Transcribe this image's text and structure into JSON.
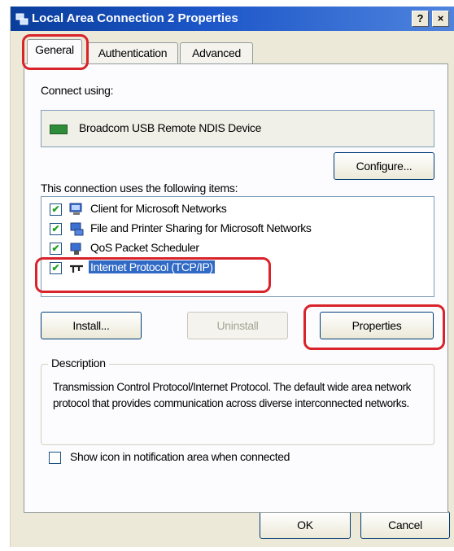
{
  "window": {
    "title": "Local Area Connection 2 Properties",
    "help_label": "?",
    "close_label": "×"
  },
  "tabs": [
    {
      "label": "General",
      "active": true
    },
    {
      "label": "Authentication",
      "active": false
    },
    {
      "label": "Advanced",
      "active": false
    }
  ],
  "general": {
    "connect_using_label": "Connect using:",
    "device_name": "Broadcom USB Remote NDIS Device",
    "configure_label": "Configure...",
    "items_label": "This connection uses the following items:",
    "items": [
      {
        "label": "Client for Microsoft Networks",
        "checked": true,
        "selected": false
      },
      {
        "label": "File and Printer Sharing for Microsoft Networks",
        "checked": true,
        "selected": false
      },
      {
        "label": "QoS Packet Scheduler",
        "checked": true,
        "selected": false
      },
      {
        "label": "Internet Protocol (TCP/IP)",
        "checked": true,
        "selected": true
      }
    ],
    "install_label": "Install...",
    "uninstall_label": "Uninstall",
    "properties_label": "Properties",
    "description_title": "Description",
    "description_text": "Transmission Control Protocol/Internet Protocol. The default wide area network protocol that provides communication across diverse interconnected networks.",
    "show_icon_label": "Show icon in notification area when connected",
    "show_icon_checked": false
  },
  "footer": {
    "ok_label": "OK",
    "cancel_label": "Cancel"
  },
  "colors": {
    "titlebar": "#0a3e9c",
    "selection": "#316ac5",
    "highlight": "#d9232b",
    "dialog_bg": "#ece9d8"
  }
}
